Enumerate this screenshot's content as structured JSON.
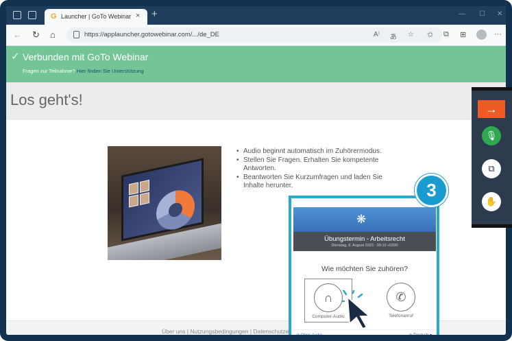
{
  "browser": {
    "tab_title": "Launcher | GoTo Webinar",
    "tab_logo": "G",
    "tab_close": "×",
    "new_tab": "+",
    "url": "https://applauncher.gotowebinar.com/.../de_DE",
    "icons": [
      "back-icon",
      "reload-icon",
      "home-icon",
      "lock-icon",
      "read-aloud-icon",
      "translate-icon",
      "favorite-icon",
      "favorites-bar-icon",
      "collections-icon",
      "extensions-icon",
      "profile-icon",
      "more-icon"
    ]
  },
  "banner": {
    "title": "Verbunden mit GoTo Webinar",
    "sub_prefix": "Fragen zur Teilnahme?",
    "sub_link": "Hier finden Sie Unterstützung"
  },
  "page": {
    "heading": "Los geht's!",
    "bullets": [
      "Audio beginnt automatisch im Zuhörermodus.",
      "Stellen Sie Fragen. Erhalten Sie kompetente Antworten.",
      "Beantworten Sie Kurzumfragen und laden Sie Inhalte herunter."
    ],
    "footer": "Über uns | Nutzungsbedingungen | Datenschutzerklärung"
  },
  "modal": {
    "title": "Übungstermin - Arbeitsrecht",
    "date": "Dienstag, 8. August 2023 · 09:10 +0200",
    "question": "Wie möchten Sie zuhören?",
    "option_computer": "Computer-Audio",
    "option_phone": "Telefonanruf",
    "no_audio": "Ohne Audio",
    "language": "Deutsch"
  },
  "step": {
    "number": "3"
  },
  "colors": {
    "banner": "#74c595",
    "accent": "#29a8d0",
    "arrow": "#f05a24",
    "mic": "#2fa84f"
  }
}
